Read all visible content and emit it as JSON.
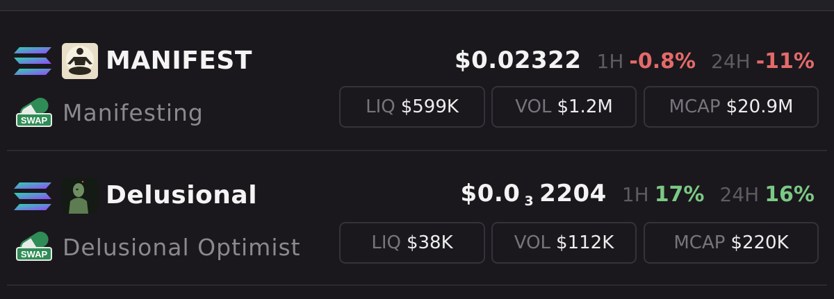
{
  "tokens": [
    {
      "symbol": "MANIFEST",
      "name": "Manifesting",
      "price": "$0.02322",
      "price_main": "$0.02322",
      "price_subscript": "",
      "price_tail": "",
      "h1_label": "1H",
      "h1_change": "-0.8%",
      "h24_label": "24H",
      "h24_change": "-11%",
      "trend": "negative",
      "liq_label": "LIQ",
      "liq_value": "$599K",
      "vol_label": "VOL",
      "vol_value": "$1.2M",
      "mcap_label": "MCAP",
      "mcap_value": "$20.9M",
      "avatar_icon": "meditating-figure-avatar"
    },
    {
      "symbol": "Delusional",
      "name": "Delusional Optimist",
      "price_main": "$0.0",
      "price_subscript": "3",
      "price_tail": "2204",
      "h1_label": "1H",
      "h1_change": "17%",
      "h24_label": "24H",
      "h24_change": "16%",
      "trend": "positive",
      "liq_label": "LIQ",
      "liq_value": "$38K",
      "vol_label": "VOL",
      "vol_value": "$112K",
      "mcap_label": "MCAP",
      "mcap_value": "$220K",
      "avatar_icon": "green-figure-avatar"
    }
  ],
  "icons": {
    "chain": "solana-icon",
    "dex": "swap-pill-icon",
    "dex_label": "SWAP"
  },
  "colors": {
    "background": "#1a181d",
    "negative": "#e46a6a",
    "positive": "#7cc885",
    "muted": "#76757b",
    "border": "#34333a"
  }
}
